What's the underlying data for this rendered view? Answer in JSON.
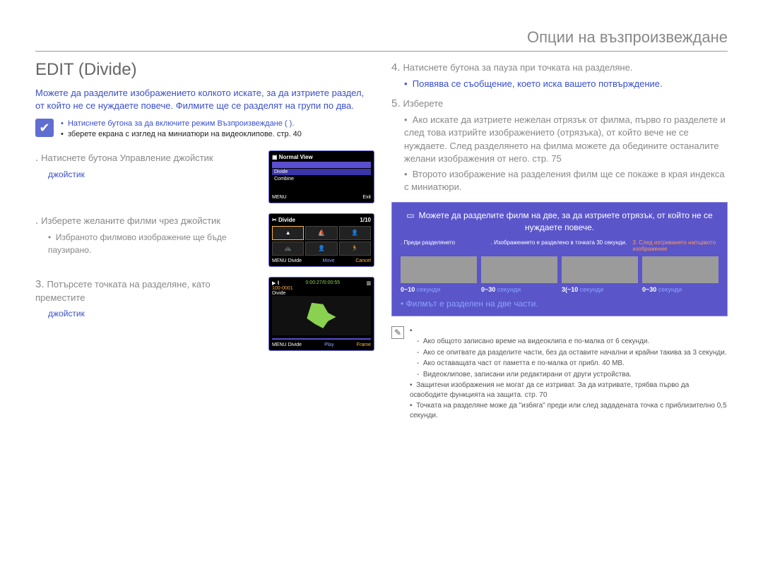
{
  "header": "Опции на възпроизвеждане",
  "title": "EDIT (Divide)",
  "intro": "Можете да разделите изображението колкото искате, за да изтриете раздел, от който не се нуждаете повече.\nФилмите ще се разделят на групи по два.",
  "prereq": {
    "b1_blue": "Натиснете бутона за да включите режим Възпроизвеждане (    ).",
    "b2_black": "зберете екрана с изглед на миниатюри на видеоклипове.  стр. 40"
  },
  "steps_left": {
    "s1": {
      "num": ".",
      "text": "Натиснете бутона  Управление джойстик",
      "extra": "джойстик"
    },
    "s2": {
      "num": ".",
      "text": "Изберете желаните филми чрез  джойстик",
      "sub": "Избраното филмово изображение ще бъде паузирано."
    },
    "s3": {
      "num": "3.",
      "text": "Потърсете точката на разделяне, като преместите ",
      "extra": "джойстик "
    }
  },
  "lcd1": {
    "title": "Normal View",
    "item_sel": "Divide",
    "item2": "Combine",
    "menu": "MENU",
    "exit": "Exit"
  },
  "lcd2": {
    "title": "Divide",
    "count": "1/10",
    "menu": "MENU",
    "divide": "Divide",
    "move": "Move",
    "cancel": "Cancel"
  },
  "lcd3": {
    "time": "0:00:27/0:00:55",
    "clip": "100-0001",
    "label": "Divide",
    "menu": "MENU",
    "divide": "Divide",
    "play": "Play",
    "frame": "Frame"
  },
  "steps_right": {
    "s4": {
      "num": "4.",
      "text": "Натиснете бутона за пауза при точката на разделяне.",
      "sub_blue": "Появява се съобщение, което иска вашето потвърждение."
    },
    "s5": {
      "num": "5.",
      "text": "Изберете ",
      "b1": "Ако искате да изтриете нежелан отрязък от филма, първо го разделете и след това изтрийте изображението (отрязъка), от който вече не се нуждаете. След разделянето на филма можете да обедините останалите желани изображения от него.  стр. 75",
      "b2": "Второто изображение на разделения филм ще се покаже в края индекса с миниатюри."
    }
  },
  "purple": {
    "head": "Можете да разделите филм на две, за да изтриете отрязък, от който не се нуждаете повече.",
    "cols": [
      {
        "num": ".",
        "txt": "Преди разделянето"
      },
      {
        "num": ".",
        "txt": "Изображението е разделено в точката 30 секунди."
      },
      {
        "num": "3.",
        "txt": "След изтриването напървото изображение"
      }
    ],
    "times": [
      {
        "a": "0~10",
        "b": "секунди"
      },
      {
        "a": "0~30",
        "b": "секунди"
      },
      {
        "a": "3(~10",
        "b": "секунди"
      },
      {
        "a": "0~30",
        "b": "секунди"
      }
    ],
    "foot": "•  Филмът е разделен на две части."
  },
  "notes": {
    "b1": "Ако общото записано време на видеоклипа е по-малка от 6 секунди.",
    "b2": "Ако се опитвате да разделите части, без да оставите начални и крайни такива за 3 секунди.",
    "b3": "Ако оставащата част от паметта е по-малка от прибл. 40 MB.",
    "b4": "Видеоклипове, записани или редактирани от други устройства.",
    "p1": "Защитени изображения не могат да се изтриват. За да изтривате, трябва първо да освободите функцията на защита.  стр. 70",
    "p2": "Точката на разделяне може да \"избяга\" преди или след зададената точка с приблизително 0,5 секунди."
  },
  "page_num": ""
}
